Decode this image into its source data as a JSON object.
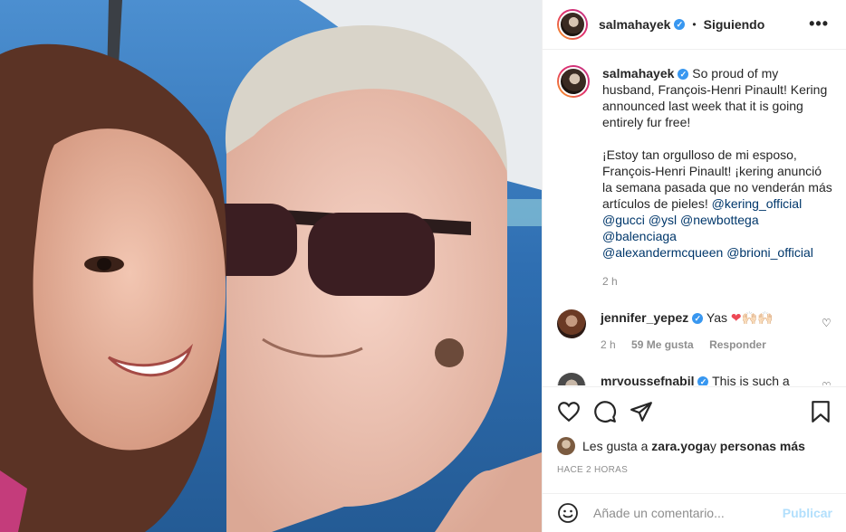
{
  "header": {
    "username": "salmahayek",
    "separator": "•",
    "follow_status": "Siguiendo",
    "more": "•••"
  },
  "caption": {
    "username": "salmahayek",
    "text_part1": "So proud of my husband, François-Henri Pinault! Kering announced last week that it is going entirely fur free!\n\n¡Estoy tan orgulloso de mi esposo, François-Henri Pinault! ¡kering anunció la semana pasada que no venderán más artículos de pieles! ",
    "mentions_line1": "@kering_official",
    "mentions_line2_a": "@gucci",
    "mentions_line2_b": "@ysl",
    "mentions_line2_c": "@newbottega",
    "mentions_line2_d": "@balenciaga",
    "mentions_line3_a": "@alexandermcqueen",
    "mentions_line3_b": "@brioni_official",
    "time": "2 h"
  },
  "comments": [
    {
      "username": "jennifer_yepez",
      "text": "Yas ",
      "emoji": "❤🙌🏻🙌🏻",
      "time": "2 h",
      "likes": "59 Me gusta",
      "reply": "Responder"
    },
    {
      "username": "mryoussefnabil",
      "text": "This is such a"
    }
  ],
  "likes": {
    "prefix": "Les gusta a ",
    "user": "zara.yoga",
    "conj": " y ",
    "others": "personas más"
  },
  "timestamp": "HACE 2 HORAS",
  "add_comment": {
    "placeholder": "Añade un comentario...",
    "publish": "Publicar"
  },
  "icons": {
    "like": "heart-icon",
    "comment": "comment-icon",
    "share": "share-icon",
    "save": "bookmark-icon",
    "emoji": "emoji-icon"
  },
  "colors": {
    "verified": "#3897f0",
    "link": "#00376b",
    "muted": "#8e8e8e",
    "publish_disabled": "#b2dffc"
  }
}
